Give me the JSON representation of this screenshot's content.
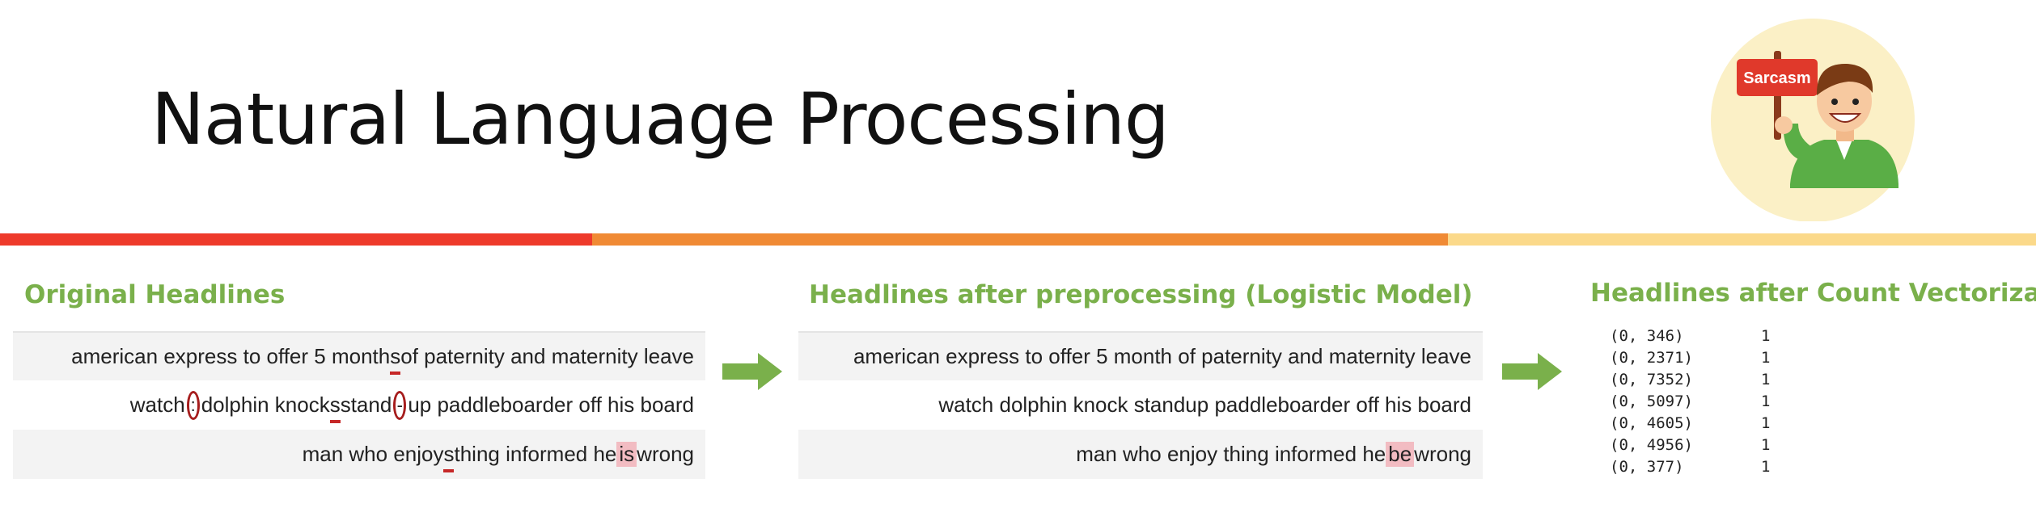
{
  "slide": {
    "title": "Natural Language Processing",
    "badge_text": "Sarcasm"
  },
  "colors": {
    "accent_red": "#ee3a2b",
    "accent_orange": "#f08a34",
    "accent_yellow": "#fbd98a",
    "heading_green": "#7ab04b",
    "highlight_pink": "#f2bcc2",
    "mark_red": "#c62828"
  },
  "original": {
    "heading": "Original Headlines",
    "row1": {
      "a": "american express to offer 5 month",
      "b": "s",
      "c": " of paternity and maternity leave"
    },
    "row2": {
      "a": "watch",
      "b": ":",
      "c": " dolphin knock",
      "d": "s",
      "e": " stand",
      "f": "-",
      "g": "up paddleboarder off his board"
    },
    "row3": {
      "a": "man who enjoy",
      "b": "s",
      "c": " thing informed he ",
      "d": "is",
      "e": " wrong"
    }
  },
  "processed": {
    "heading": "Headlines after preprocessing (Logistic Model)",
    "row1": "american express to offer 5 month of paternity and maternity leave",
    "row2": "watch dolphin knock standup paddleboarder off his board",
    "row3": {
      "a": "man who enjoy thing informed he ",
      "b": "be",
      "c": " wrong"
    }
  },
  "vectorized": {
    "heading": "Headlines after Count Vectorization",
    "rows": [
      {
        "pair": "(0, 346)",
        "count": "1"
      },
      {
        "pair": "(0, 2371)",
        "count": "1"
      },
      {
        "pair": "(0, 7352)",
        "count": "1"
      },
      {
        "pair": "(0, 5097)",
        "count": "1"
      },
      {
        "pair": "(0, 4605)",
        "count": "1"
      },
      {
        "pair": "(0, 4956)",
        "count": "1"
      },
      {
        "pair": "(0, 377)",
        "count": "1"
      }
    ]
  },
  "icons": [
    "right-arrow-icon",
    "person-holding-sarcasm-sign-icon"
  ]
}
